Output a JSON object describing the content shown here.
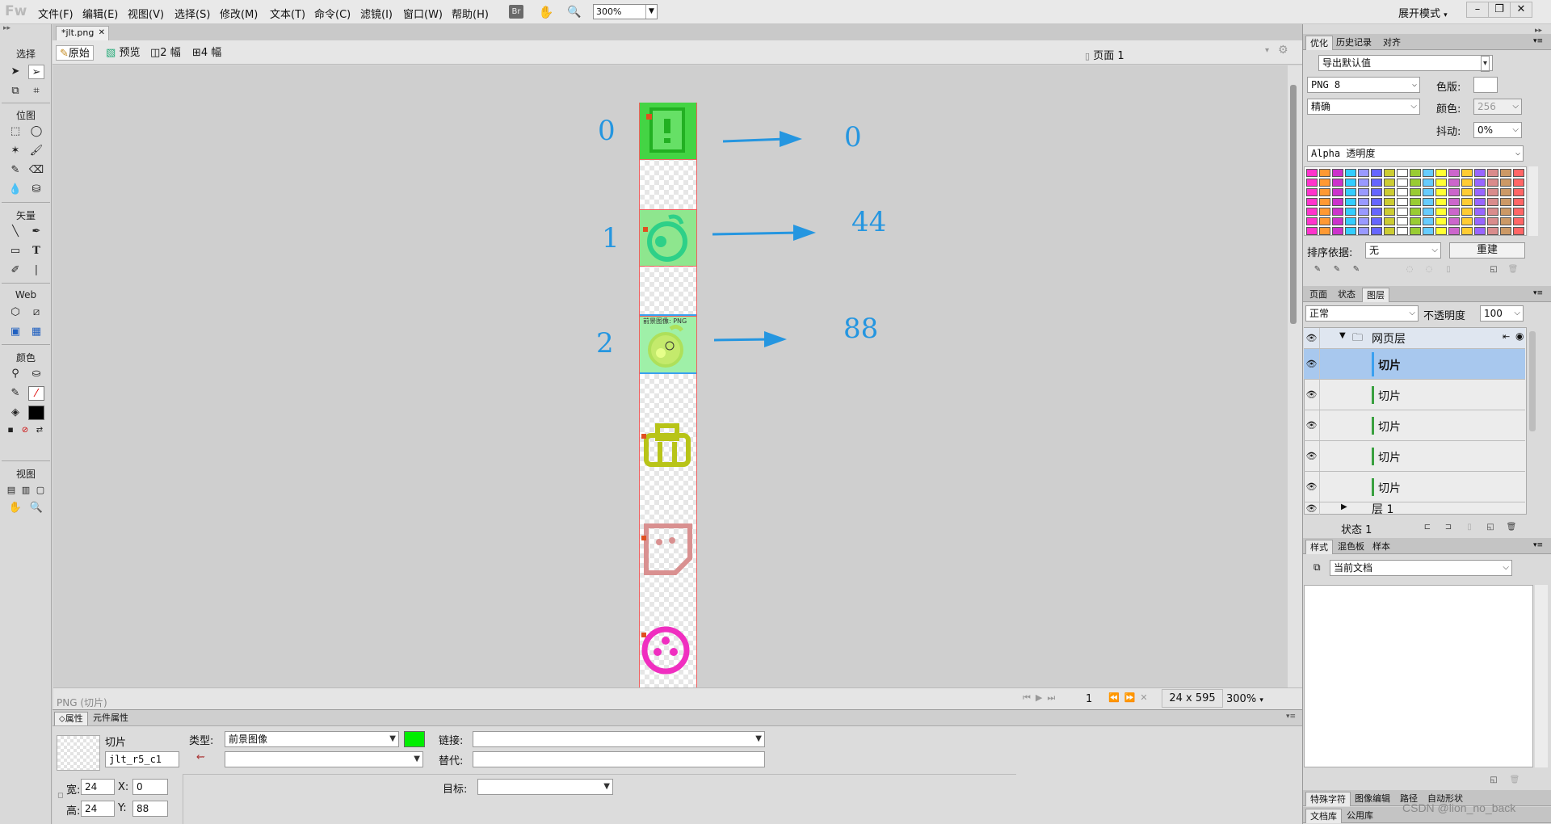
{
  "app": {
    "logo": "Fw",
    "workspace": "展开模式",
    "zoom": "300%",
    "bridge": "Br"
  },
  "menu": [
    "文件(F)",
    "编辑(E)",
    "视图(V)",
    "选择(S)",
    "修改(M)",
    "文本(T)",
    "命令(C)",
    "滤镜(I)",
    "窗口(W)",
    "帮助(H)"
  ],
  "toolbox": {
    "sections": [
      "选择",
      "位图",
      "矢量",
      "Web",
      "颜色",
      "视图"
    ]
  },
  "document": {
    "tab": "*jlt.png",
    "view_buttons": [
      "原始",
      "预览",
      "2 幅",
      "4 幅"
    ],
    "page": "页面 1",
    "slice_label": "前景图像: PNG",
    "status_left": "PNG (切片)",
    "frame": "1",
    "dimensions": "24 x 595",
    "zoom": "300%"
  },
  "annotations": {
    "left": [
      "0",
      "1",
      "2"
    ],
    "right": [
      "0",
      "44",
      "88"
    ]
  },
  "properties": {
    "tabs": [
      "属性",
      "元件属性"
    ],
    "object_type": "切片",
    "slice_name": "jlt_r5_c1",
    "type_label": "类型:",
    "type_value": "前景图像",
    "link_label": "链接:",
    "link_value": "",
    "alt_label": "替代:",
    "alt_value": "",
    "target_label": "目标:",
    "target_value": "",
    "width_label": "宽:",
    "width": "24",
    "height_label": "高:",
    "height": "24",
    "x_label": "X:",
    "x": "0",
    "y_label": "Y:",
    "y": "88",
    "slice_color": "#00ee00"
  },
  "optimize": {
    "tabs": [
      "优化",
      "历史记录",
      "对齐"
    ],
    "preset": "导出默认值",
    "format": "PNG 8",
    "palette": "精确",
    "matte_label": "色版:",
    "colors_label": "颜色:",
    "colors": "256",
    "dither_label": "抖动:",
    "dither": "0%",
    "transparency": "Alpha 透明度",
    "sort_label": "排序依据:",
    "sort_value": "无",
    "rebuild": "重建",
    "swatches": [
      "#ff33cc",
      "#ffffff",
      "#d98c8c",
      "#996699",
      "#9999ff",
      "#cc66cc",
      "#33cccc",
      "#ff9933",
      "#99cc33",
      "#cc9966",
      "#ff3399",
      "#6666ff",
      "#ffcc33",
      "#33cc99",
      "#cc33cc",
      "#66ccff",
      "#ff6666",
      "#99ff33",
      "#cccc33",
      "#9966ff",
      "#ff00ff",
      "#33ccff",
      "#ffff33",
      "#cc6633"
    ]
  },
  "layers": {
    "tabs": [
      "页面",
      "状态",
      "图层"
    ],
    "blend": "正常",
    "opacity_label": "不透明度",
    "opacity": "100",
    "web_layer": "网页层",
    "items": [
      "切片",
      "切片",
      "切片",
      "切片",
      "切片"
    ],
    "layer1": "层 1",
    "state": "状态 1"
  },
  "styles": {
    "tabs": [
      "样式",
      "混色板",
      "样本"
    ],
    "source": "当前文档"
  },
  "bottom_tabs": {
    "row1": [
      "特殊字符",
      "图像编辑",
      "路径",
      "自动形状"
    ],
    "row2": [
      "文档库",
      "公用库"
    ]
  },
  "watermark": "CSDN @lion_no_back"
}
